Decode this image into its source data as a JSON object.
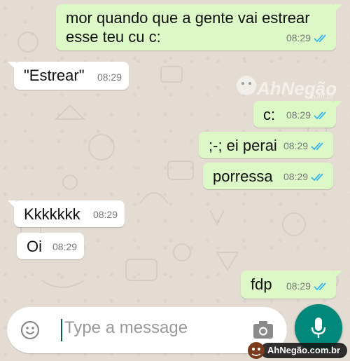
{
  "messages": [
    {
      "text": "mor quando que a gente vai estrear",
      "text2": "esse teu cu c:",
      "time": "08:29",
      "direction": "outgoing",
      "status": "read"
    },
    {
      "text": "\"Estrear\"",
      "time": "08:29",
      "direction": "incoming"
    },
    {
      "text": "c:",
      "time": "08:29",
      "direction": "outgoing",
      "status": "read"
    },
    {
      "text": ";-; ei perai",
      "time": "08:29",
      "direction": "outgoing",
      "status": "read"
    },
    {
      "text": "porressa",
      "time": "08:29",
      "direction": "outgoing",
      "status": "read"
    },
    {
      "text": "Kkkkkkk",
      "time": "08:29",
      "direction": "incoming"
    },
    {
      "text": "Oi",
      "time": "08:29",
      "direction": "incoming"
    },
    {
      "text": "fdp",
      "time": "08:29",
      "direction": "outgoing",
      "status": "read"
    }
  ],
  "composer": {
    "placeholder": "Type a message",
    "emoji_icon": "emoji-icon",
    "camera_icon": "camera-icon",
    "mic_icon": "microphone-icon"
  },
  "watermark": {
    "logo_text": "AhNegão",
    "logo_sub": ".com.br",
    "badge_text": "AhNegão.com.br"
  },
  "colors": {
    "outgoing_bubble": "#dcf8c6",
    "incoming_bubble": "#ffffff",
    "read_ticks": "#34b7f1",
    "mic_button": "#00897b",
    "chat_background": "#e4dcd3"
  }
}
